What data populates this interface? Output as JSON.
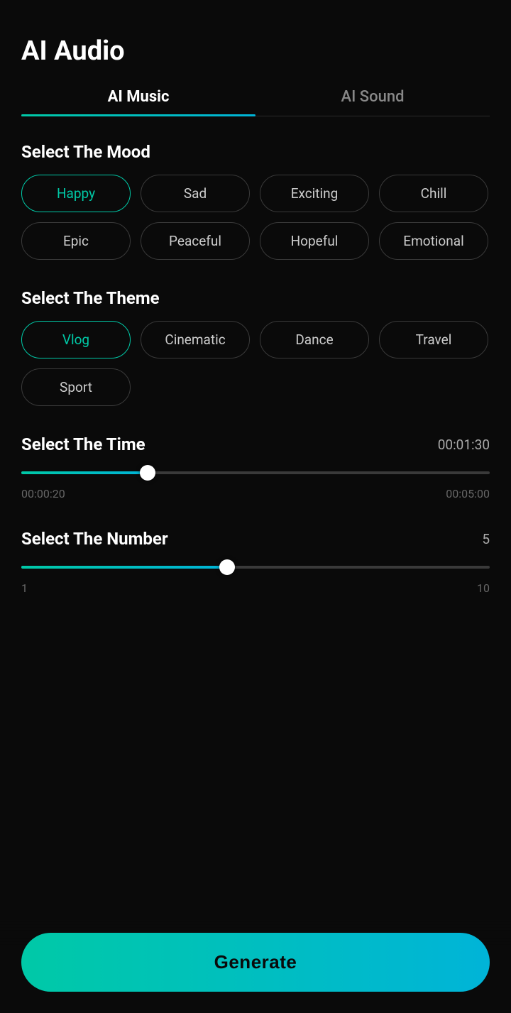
{
  "page": {
    "title": "AI Audio"
  },
  "tabs": [
    {
      "id": "ai-music",
      "label": "AI Music",
      "active": true
    },
    {
      "id": "ai-sound",
      "label": "AI Sound",
      "active": false
    }
  ],
  "mood_section": {
    "label": "Select The Mood",
    "chips": [
      {
        "id": "happy",
        "label": "Happy",
        "active": true
      },
      {
        "id": "sad",
        "label": "Sad",
        "active": false
      },
      {
        "id": "exciting",
        "label": "Exciting",
        "active": false
      },
      {
        "id": "chill",
        "label": "Chill",
        "active": false
      },
      {
        "id": "epic",
        "label": "Epic",
        "active": false
      },
      {
        "id": "peaceful",
        "label": "Peaceful",
        "active": false
      },
      {
        "id": "hopeful",
        "label": "Hopeful",
        "active": false
      },
      {
        "id": "emotional",
        "label": "Emotional",
        "active": false
      }
    ]
  },
  "theme_section": {
    "label": "Select The Theme",
    "chips": [
      {
        "id": "vlog",
        "label": "Vlog",
        "active": true
      },
      {
        "id": "cinematic",
        "label": "Cinematic",
        "active": false
      },
      {
        "id": "dance",
        "label": "Dance",
        "active": false
      },
      {
        "id": "travel",
        "label": "Travel",
        "active": false
      },
      {
        "id": "sport",
        "label": "Sport",
        "active": false
      }
    ]
  },
  "time_section": {
    "label": "Select The Time",
    "value": "00:01:30",
    "min_label": "00:00:20",
    "max_label": "00:05:00",
    "fill_percent": 27
  },
  "number_section": {
    "label": "Select The Number",
    "value": "5",
    "min_label": "1",
    "max_label": "10",
    "fill_percent": 44
  },
  "generate_button": {
    "label": "Generate"
  }
}
